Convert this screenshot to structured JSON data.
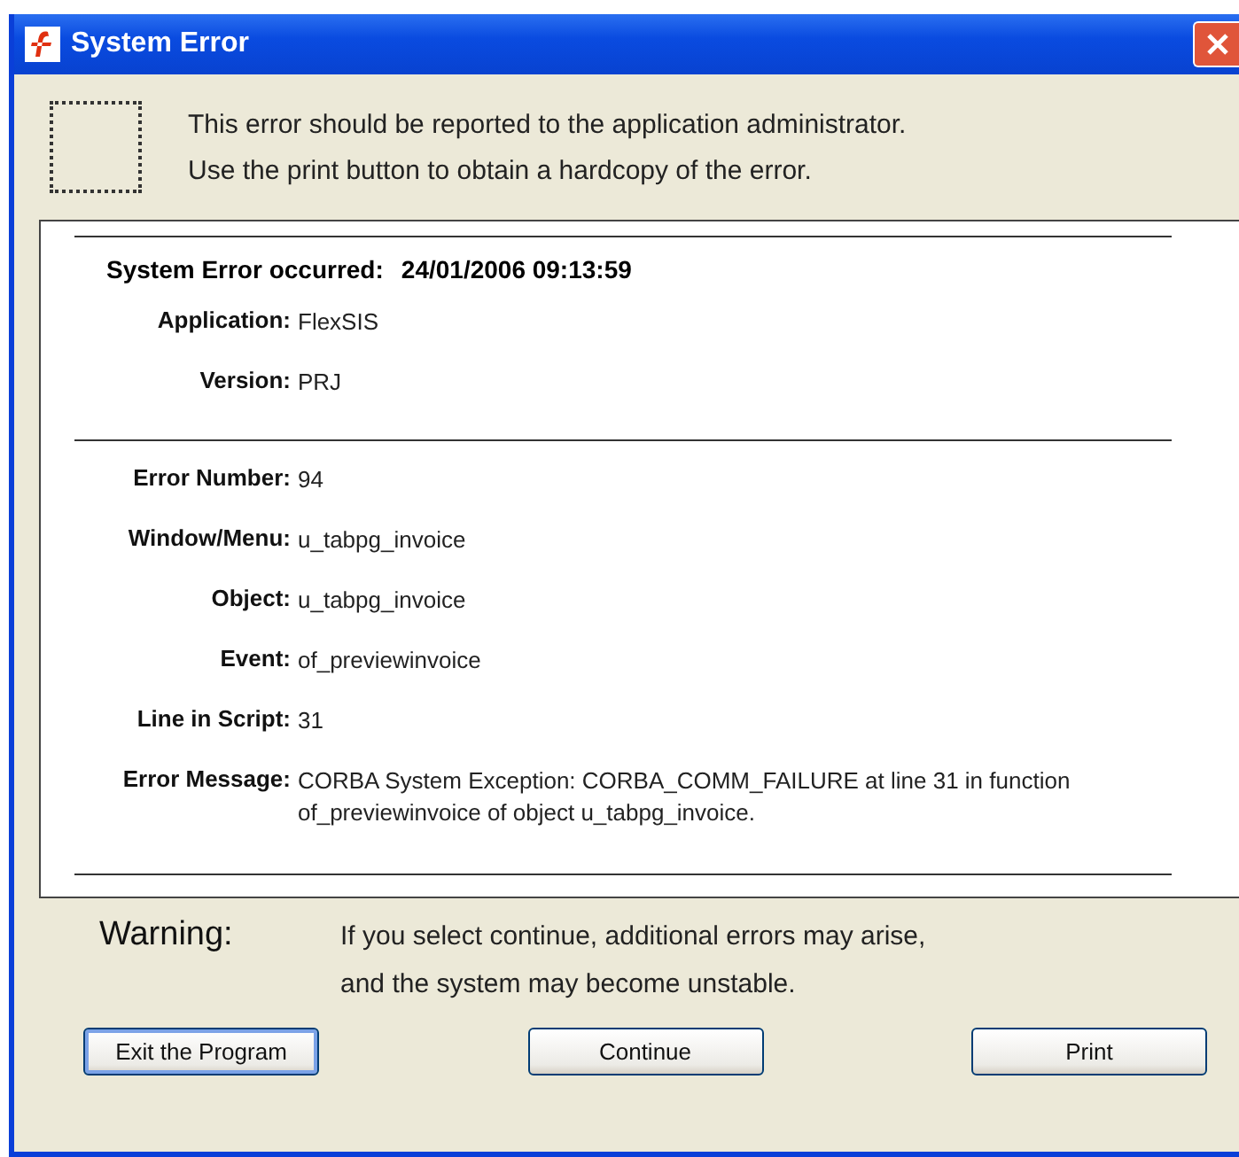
{
  "window": {
    "title": "System Error"
  },
  "message": [
    "This error should be reported to the application administrator.",
    "Use the print button to obtain a hardcopy of the error."
  ],
  "header": {
    "label": "System Error occurred:",
    "value": "24/01/2006  09:13:59"
  },
  "groups": [
    [
      {
        "label": "Application:",
        "value": "FlexSIS"
      },
      {
        "label": "Version:",
        "value": "PRJ"
      }
    ],
    [
      {
        "label": "Error Number:",
        "value": "94"
      },
      {
        "label": "Window/Menu:",
        "value": "u_tabpg_invoice"
      },
      {
        "label": "Object:",
        "value": "u_tabpg_invoice"
      },
      {
        "label": "Event:",
        "value": "of_previewinvoice"
      },
      {
        "label": "Line in Script:",
        "value": "31"
      },
      {
        "label": "Error Message:",
        "value": "CORBA System Exception: CORBA_COMM_FAILURE at line 31 in function of_previewinvoice of object u_tabpg_invoice."
      }
    ]
  ],
  "warning": {
    "label": "Warning:",
    "lines": [
      "If you select continue, additional errors may arise,",
      "and the system may become unstable."
    ]
  },
  "buttons": [
    {
      "label": "Exit the Program",
      "focused": true
    },
    {
      "label": "Continue",
      "focused": false
    },
    {
      "label": "Print",
      "focused": false
    }
  ]
}
